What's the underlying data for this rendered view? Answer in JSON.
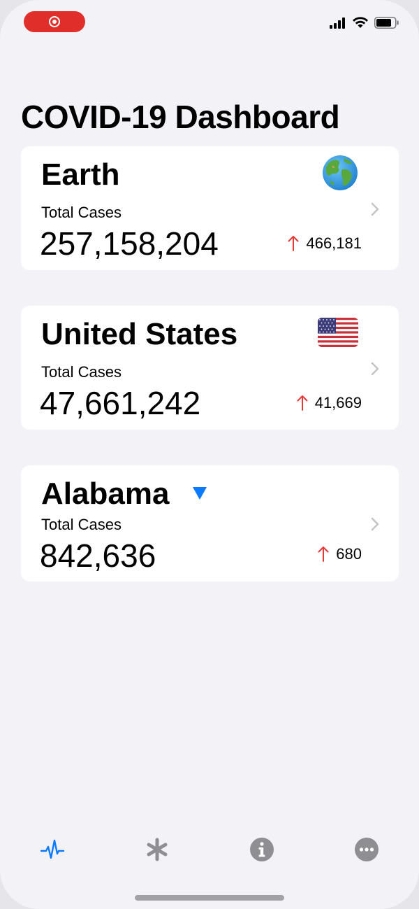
{
  "app": {
    "title": "COVID-19 Dashboard"
  },
  "status_bar": {
    "recording_indicator": "record-icon",
    "icons": [
      "cellular-signal-icon",
      "wifi-icon",
      "battery-icon"
    ]
  },
  "cards": [
    {
      "title": "Earth",
      "subtitle": "Total Cases",
      "value": "257,158,204",
      "change": "466,181",
      "icon": "globe-icon"
    },
    {
      "title": "United States",
      "subtitle": "Total Cases",
      "value": "47,661,242",
      "change": "41,669",
      "icon": "us-flag-icon"
    },
    {
      "title": "Alabama",
      "subtitle": "Total Cases",
      "value": "842,636",
      "change": "680",
      "icon": "dropdown-triangle-icon"
    }
  ],
  "tab_bar": {
    "tabs": [
      {
        "icon": "pulse-icon",
        "selected": true
      },
      {
        "icon": "asterisk-icon",
        "selected": false
      },
      {
        "icon": "info-icon",
        "selected": false
      },
      {
        "icon": "more-icon",
        "selected": false
      }
    ]
  },
  "colors": {
    "background": "#f2f2f7",
    "card": "#ffffff",
    "accent": "#0a7aff",
    "increase": "#e53935",
    "tab_inactive": "#8e8e93",
    "recording": "#e02f2a"
  }
}
